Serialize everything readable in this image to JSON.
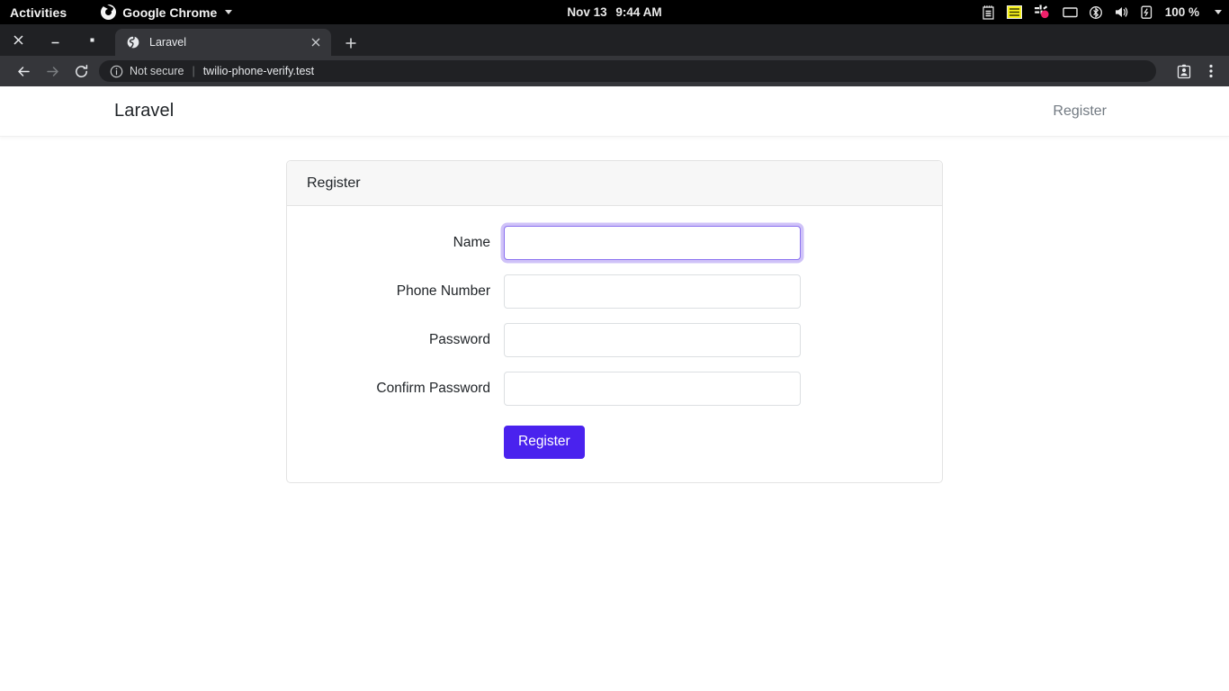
{
  "desktop": {
    "activities_label": "Activities",
    "app_menu_label": "Google Chrome",
    "app_menu_icon": "chrome-logo-icon",
    "clock_date": "Nov 13",
    "clock_time": "9:44 AM",
    "tray": {
      "icons": [
        "notepad-icon",
        "list-icon",
        "pinwheel-indicator-icon",
        "display-icon",
        "bluetooth-icon",
        "volume-icon",
        "battery-icon"
      ],
      "battery_percent": "100 %"
    }
  },
  "browser": {
    "window_controls": [
      "close",
      "minimize",
      "maximize"
    ],
    "tab": {
      "title": "Laravel",
      "favicon": "globe-icon",
      "close_label": "×"
    },
    "new_tab_label": "+",
    "toolbar": {
      "back_icon": "back-arrow-icon",
      "forward_icon": "forward-arrow-icon",
      "reload_icon": "reload-icon",
      "security_icon": "info-circle-icon",
      "security_text": "Not secure",
      "separator": "|",
      "url": "twilio-phone-verify.test",
      "profile_icon": "profile-card-icon",
      "menu_icon": "three-dot-menu-icon"
    }
  },
  "page": {
    "navbar": {
      "brand": "Laravel",
      "links": [
        {
          "label": "Register"
        }
      ]
    },
    "card": {
      "header_title": "Register",
      "fields": [
        {
          "label": "Name",
          "value": "",
          "placeholder": "",
          "type": "text",
          "focused": true
        },
        {
          "label": "Phone Number",
          "value": "",
          "placeholder": "",
          "type": "text",
          "focused": false
        },
        {
          "label": "Password",
          "value": "",
          "placeholder": "",
          "type": "password",
          "focused": false
        },
        {
          "label": "Confirm Password",
          "value": "",
          "placeholder": "",
          "type": "password",
          "focused": false
        }
      ],
      "submit_label": "Register"
    }
  },
  "colors": {
    "primary_button": "#4a22ee",
    "focus_ring": "#cfc2f8",
    "focus_border": "#8b72f0",
    "card_header_bg": "#f7f7f7",
    "card_border": "#e3e3e3",
    "nav_link": "#727a82",
    "gnome_bar_bg": "#000000",
    "tabstrip_bg": "#202124",
    "toolbar_bg": "#35363a"
  }
}
